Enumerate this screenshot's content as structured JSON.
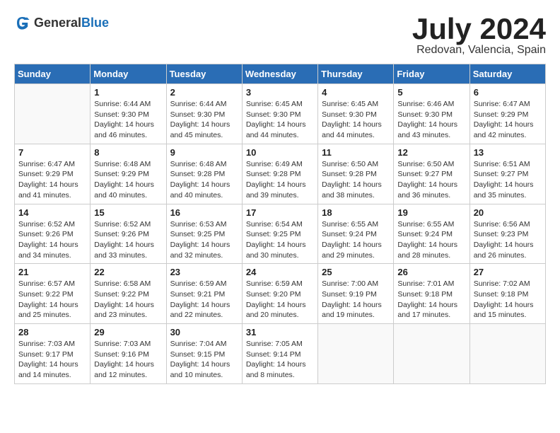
{
  "header": {
    "logo_general": "General",
    "logo_blue": "Blue",
    "month_title": "July 2024",
    "subtitle": "Redovan, Valencia, Spain"
  },
  "weekdays": [
    "Sunday",
    "Monday",
    "Tuesday",
    "Wednesday",
    "Thursday",
    "Friday",
    "Saturday"
  ],
  "rows": [
    [
      {
        "day": "",
        "lines": []
      },
      {
        "day": "1",
        "lines": [
          "Sunrise: 6:44 AM",
          "Sunset: 9:30 PM",
          "Daylight: 14 hours",
          "and 46 minutes."
        ]
      },
      {
        "day": "2",
        "lines": [
          "Sunrise: 6:44 AM",
          "Sunset: 9:30 PM",
          "Daylight: 14 hours",
          "and 45 minutes."
        ]
      },
      {
        "day": "3",
        "lines": [
          "Sunrise: 6:45 AM",
          "Sunset: 9:30 PM",
          "Daylight: 14 hours",
          "and 44 minutes."
        ]
      },
      {
        "day": "4",
        "lines": [
          "Sunrise: 6:45 AM",
          "Sunset: 9:30 PM",
          "Daylight: 14 hours",
          "and 44 minutes."
        ]
      },
      {
        "day": "5",
        "lines": [
          "Sunrise: 6:46 AM",
          "Sunset: 9:30 PM",
          "Daylight: 14 hours",
          "and 43 minutes."
        ]
      },
      {
        "day": "6",
        "lines": [
          "Sunrise: 6:47 AM",
          "Sunset: 9:29 PM",
          "Daylight: 14 hours",
          "and 42 minutes."
        ]
      }
    ],
    [
      {
        "day": "7",
        "lines": [
          "Sunrise: 6:47 AM",
          "Sunset: 9:29 PM",
          "Daylight: 14 hours",
          "and 41 minutes."
        ]
      },
      {
        "day": "8",
        "lines": [
          "Sunrise: 6:48 AM",
          "Sunset: 9:29 PM",
          "Daylight: 14 hours",
          "and 40 minutes."
        ]
      },
      {
        "day": "9",
        "lines": [
          "Sunrise: 6:48 AM",
          "Sunset: 9:28 PM",
          "Daylight: 14 hours",
          "and 40 minutes."
        ]
      },
      {
        "day": "10",
        "lines": [
          "Sunrise: 6:49 AM",
          "Sunset: 9:28 PM",
          "Daylight: 14 hours",
          "and 39 minutes."
        ]
      },
      {
        "day": "11",
        "lines": [
          "Sunrise: 6:50 AM",
          "Sunset: 9:28 PM",
          "Daylight: 14 hours",
          "and 38 minutes."
        ]
      },
      {
        "day": "12",
        "lines": [
          "Sunrise: 6:50 AM",
          "Sunset: 9:27 PM",
          "Daylight: 14 hours",
          "and 36 minutes."
        ]
      },
      {
        "day": "13",
        "lines": [
          "Sunrise: 6:51 AM",
          "Sunset: 9:27 PM",
          "Daylight: 14 hours",
          "and 35 minutes."
        ]
      }
    ],
    [
      {
        "day": "14",
        "lines": [
          "Sunrise: 6:52 AM",
          "Sunset: 9:26 PM",
          "Daylight: 14 hours",
          "and 34 minutes."
        ]
      },
      {
        "day": "15",
        "lines": [
          "Sunrise: 6:52 AM",
          "Sunset: 9:26 PM",
          "Daylight: 14 hours",
          "and 33 minutes."
        ]
      },
      {
        "day": "16",
        "lines": [
          "Sunrise: 6:53 AM",
          "Sunset: 9:25 PM",
          "Daylight: 14 hours",
          "and 32 minutes."
        ]
      },
      {
        "day": "17",
        "lines": [
          "Sunrise: 6:54 AM",
          "Sunset: 9:25 PM",
          "Daylight: 14 hours",
          "and 30 minutes."
        ]
      },
      {
        "day": "18",
        "lines": [
          "Sunrise: 6:55 AM",
          "Sunset: 9:24 PM",
          "Daylight: 14 hours",
          "and 29 minutes."
        ]
      },
      {
        "day": "19",
        "lines": [
          "Sunrise: 6:55 AM",
          "Sunset: 9:24 PM",
          "Daylight: 14 hours",
          "and 28 minutes."
        ]
      },
      {
        "day": "20",
        "lines": [
          "Sunrise: 6:56 AM",
          "Sunset: 9:23 PM",
          "Daylight: 14 hours",
          "and 26 minutes."
        ]
      }
    ],
    [
      {
        "day": "21",
        "lines": [
          "Sunrise: 6:57 AM",
          "Sunset: 9:22 PM",
          "Daylight: 14 hours",
          "and 25 minutes."
        ]
      },
      {
        "day": "22",
        "lines": [
          "Sunrise: 6:58 AM",
          "Sunset: 9:22 PM",
          "Daylight: 14 hours",
          "and 23 minutes."
        ]
      },
      {
        "day": "23",
        "lines": [
          "Sunrise: 6:59 AM",
          "Sunset: 9:21 PM",
          "Daylight: 14 hours",
          "and 22 minutes."
        ]
      },
      {
        "day": "24",
        "lines": [
          "Sunrise: 6:59 AM",
          "Sunset: 9:20 PM",
          "Daylight: 14 hours",
          "and 20 minutes."
        ]
      },
      {
        "day": "25",
        "lines": [
          "Sunrise: 7:00 AM",
          "Sunset: 9:19 PM",
          "Daylight: 14 hours",
          "and 19 minutes."
        ]
      },
      {
        "day": "26",
        "lines": [
          "Sunrise: 7:01 AM",
          "Sunset: 9:18 PM",
          "Daylight: 14 hours",
          "and 17 minutes."
        ]
      },
      {
        "day": "27",
        "lines": [
          "Sunrise: 7:02 AM",
          "Sunset: 9:18 PM",
          "Daylight: 14 hours",
          "and 15 minutes."
        ]
      }
    ],
    [
      {
        "day": "28",
        "lines": [
          "Sunrise: 7:03 AM",
          "Sunset: 9:17 PM",
          "Daylight: 14 hours",
          "and 14 minutes."
        ]
      },
      {
        "day": "29",
        "lines": [
          "Sunrise: 7:03 AM",
          "Sunset: 9:16 PM",
          "Daylight: 14 hours",
          "and 12 minutes."
        ]
      },
      {
        "day": "30",
        "lines": [
          "Sunrise: 7:04 AM",
          "Sunset: 9:15 PM",
          "Daylight: 14 hours",
          "and 10 minutes."
        ]
      },
      {
        "day": "31",
        "lines": [
          "Sunrise: 7:05 AM",
          "Sunset: 9:14 PM",
          "Daylight: 14 hours",
          "and 8 minutes."
        ]
      },
      {
        "day": "",
        "lines": []
      },
      {
        "day": "",
        "lines": []
      },
      {
        "day": "",
        "lines": []
      }
    ]
  ]
}
